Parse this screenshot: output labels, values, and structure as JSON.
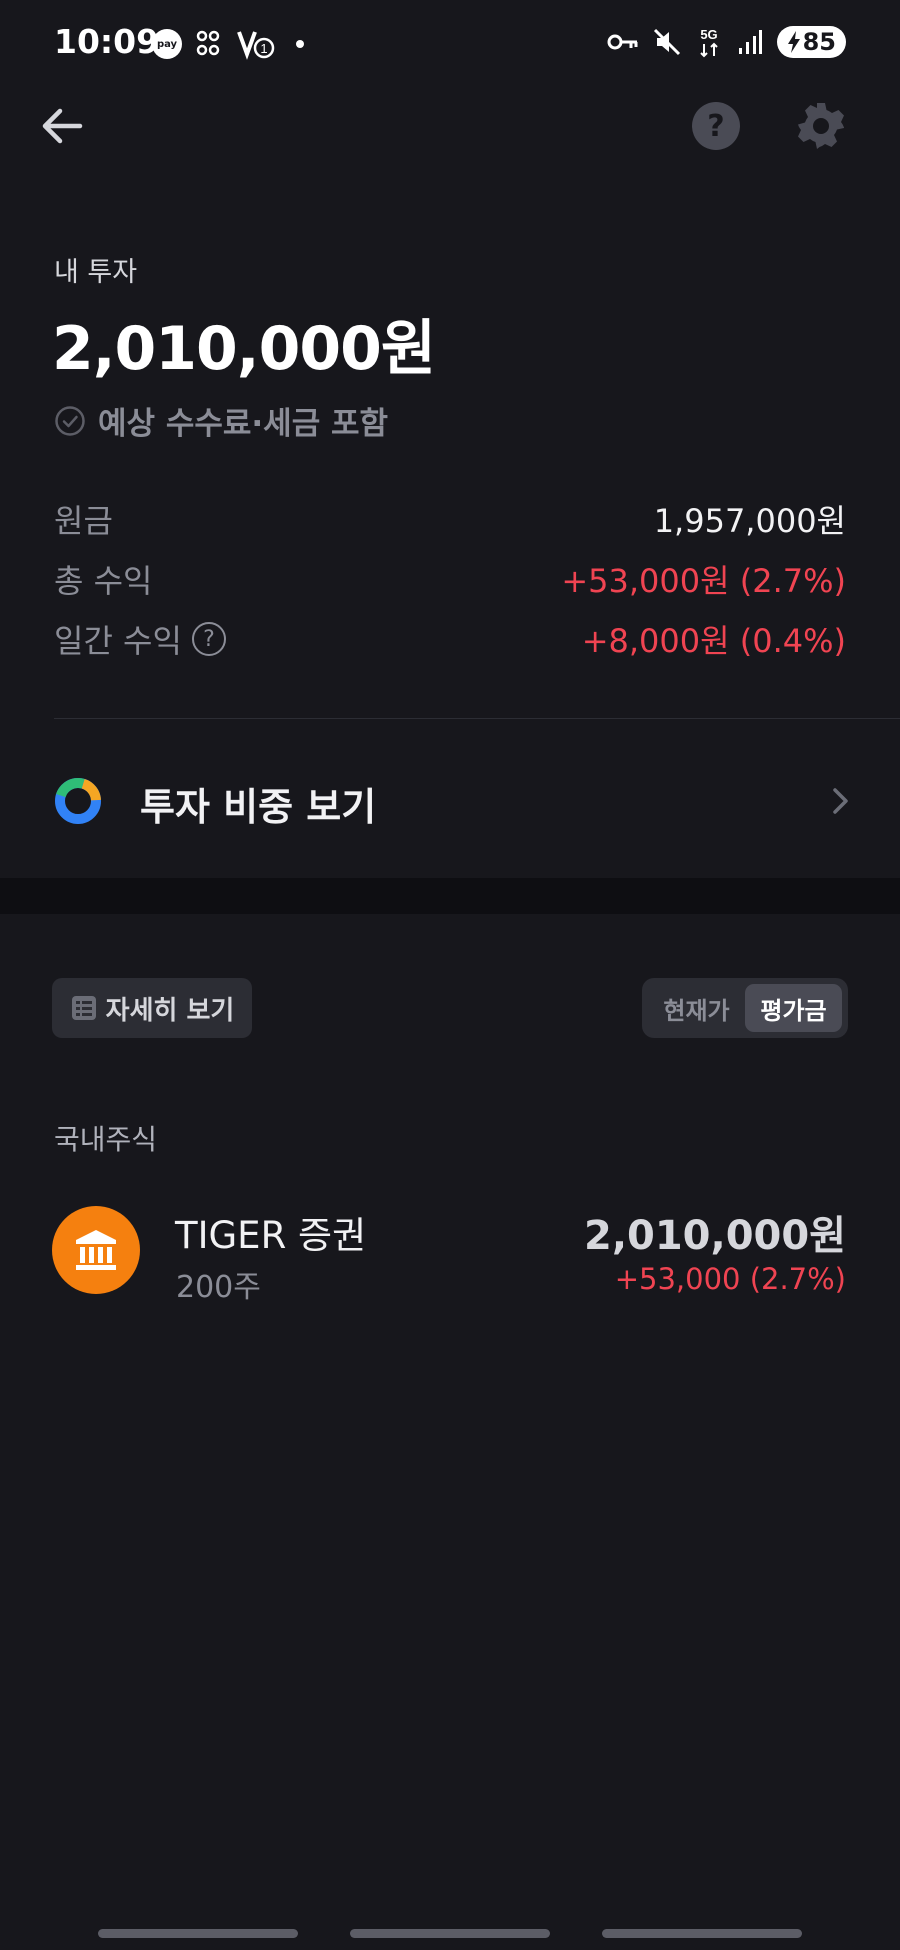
{
  "status_bar": {
    "time": "10:09",
    "pay_label": "pay",
    "battery": "85",
    "icons": [
      "pay-icon",
      "dots-icon",
      "vpn-icon",
      "key-icon",
      "mute-icon",
      "5g-icon",
      "signal-icon",
      "battery-icon"
    ]
  },
  "header": {
    "back_icon": "arrow-left-icon",
    "help_icon": "question-icon",
    "help_glyph": "?",
    "settings_icon": "gear-icon"
  },
  "summary": {
    "label": "내 투자",
    "total": "2,010,000원",
    "fee_note": "예상 수수료·세금 포함",
    "rows": [
      {
        "label": "원금",
        "value": "1,957,000원"
      },
      {
        "label": "총 수익",
        "value": "+53,000원 (2.7%)"
      },
      {
        "label": "일간 수익",
        "value": "+8,000원 (0.4%)",
        "help_glyph": "?"
      }
    ]
  },
  "ratio_link": {
    "label": "투자 비중 보기",
    "donut_colors": [
      "#3182f6",
      "#2fbd77",
      "#f5a623"
    ]
  },
  "controls": {
    "detail_label": "자세히 보기",
    "toggle": [
      "현재가",
      "평가금"
    ],
    "toggle_selected": "평가금"
  },
  "holdings": {
    "section_title": "국내주식",
    "items": [
      {
        "name": "TIGER 증권",
        "qty": "200주",
        "value": "2,010,000원",
        "change": "+53,000 (2.7%)"
      }
    ]
  },
  "colors": {
    "background": "#17171c",
    "positive": "#f04452",
    "logo": "#f5800f"
  }
}
